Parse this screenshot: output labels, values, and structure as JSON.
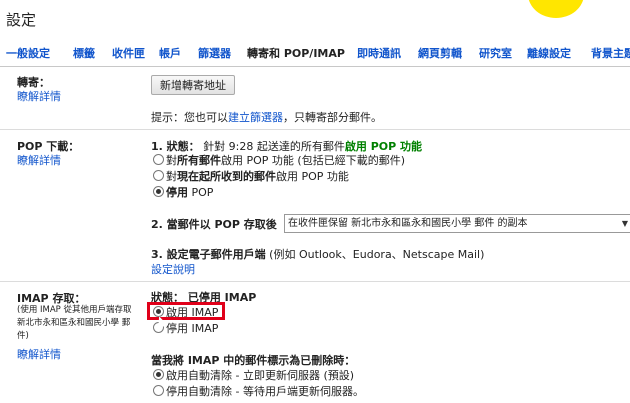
{
  "window": {
    "title": "設定"
  },
  "tabs": [
    {
      "label": "一般設定"
    },
    {
      "label": "標籤"
    },
    {
      "label": "收件匣"
    },
    {
      "label": "帳戶"
    },
    {
      "label": "篩選器"
    },
    {
      "label": "轉寄和 POP/IMAP"
    },
    {
      "label": "即時通訊"
    },
    {
      "label": "網頁剪輯"
    },
    {
      "label": "研究室"
    },
    {
      "label": "離線設定"
    },
    {
      "label": "背景主題"
    }
  ],
  "forwarding": {
    "label": "轉寄：",
    "learn_more": "瞭解詳情",
    "add_button": "新增轉寄地址",
    "tip_prefix": "提示：您也可以",
    "tip_link": "建立篩選器",
    "tip_suffix": "，只轉寄部分郵件。"
  },
  "pop": {
    "label": "POP 下載：",
    "learn_more": "瞭解詳情",
    "status_prefix": "1. 狀態：",
    "status_text": "針對 9:28 起送達的所有郵件",
    "status_enabled": "啟用 POP 功能",
    "options": [
      {
        "prefix": "對",
        "bold": "所有郵件",
        "suffix": "啟用 POP 功能 (包括已經下載的郵件)",
        "selected": false
      },
      {
        "prefix": "對",
        "bold": "現在起所收到的郵件",
        "suffix": "啟用 POP 功能",
        "selected": false
      },
      {
        "prefix": "",
        "bold": "停用",
        "suffix": " POP",
        "selected": true
      }
    ],
    "when_accessed": "2. 當郵件以 POP 存取後",
    "when_accessed_value": "在收件匣保留 新北市永和區永和國民小學 郵件 的副本",
    "configure_client_bold": "3. 設定電子郵件用戶端",
    "configure_client_rest": " (例如 Outlook、Eudora、Netscape Mail)",
    "config_instructions": "設定說明"
  },
  "imap": {
    "label": "IMAP 存取：",
    "sublabel": "(使用 IMAP 從其他用戶端存取 新北市永和區永和國民小學 郵件)",
    "learn_more": "瞭解詳情",
    "status": "狀態： 已停用 IMAP",
    "options": [
      {
        "label": "啟用 IMAP",
        "selected": true
      },
      {
        "label": "停用 IMAP",
        "selected": false
      }
    ],
    "deleted_heading": "當我將 IMAP 中的郵件標示為已刪除時：",
    "expunge_options": [
      {
        "label": "啟用自動清除 - 立即更新伺服器 (預設)",
        "selected": true
      },
      {
        "label": "停用自動清除 - 等待用戶端更新伺服器。",
        "selected": false
      }
    ]
  },
  "colors": {
    "link": "#1155cc",
    "enabled_green": "#008000",
    "highlight_box": "#e0001a"
  }
}
